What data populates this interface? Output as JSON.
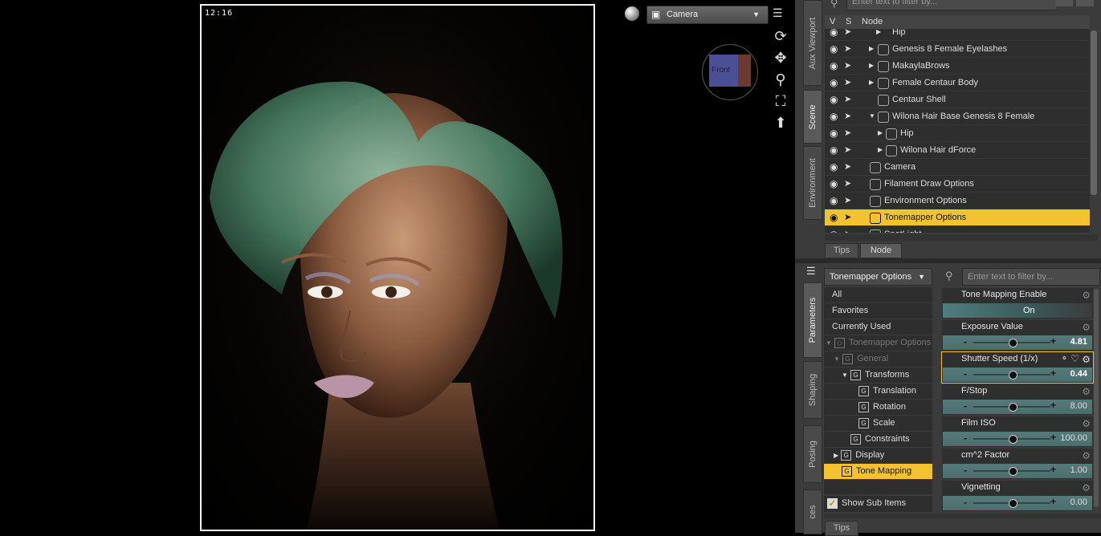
{
  "viewport": {
    "time": "12:16",
    "camera": "Camera",
    "gizmo_label": "Front"
  },
  "side_tabs_top": [
    "Aux Viewport",
    "Scene",
    "Environment"
  ],
  "side_tabs_bottom": [
    "Parameters",
    "Shaping",
    "Posing",
    "ces"
  ],
  "scene": {
    "filter_placeholder": "Enter text to filter by...",
    "col_v": "V",
    "col_s": "S",
    "col_node": "Node",
    "rows": [
      {
        "name": "Hip"
      },
      {
        "name": "Genesis 8 Female Eyelashes"
      },
      {
        "name": "MakaylaBrows"
      },
      {
        "name": "Female Centaur Body"
      },
      {
        "name": "Centaur Shell"
      },
      {
        "name": "Wilona Hair Base Genesis 8 Female"
      },
      {
        "name": "Hip"
      },
      {
        "name": "Wilona Hair dForce"
      },
      {
        "name": "Camera"
      },
      {
        "name": "Filament Draw Options"
      },
      {
        "name": "Environment Options"
      },
      {
        "name": "Tonemapper Options"
      },
      {
        "name": "SpotLight"
      }
    ],
    "bottom_tabs": [
      "Tips",
      "Node"
    ]
  },
  "params": {
    "node_select": "Tonemapper Options",
    "filter_placeholder": "Enter text to filter by...",
    "tree": [
      {
        "label": "All"
      },
      {
        "label": "Favorites"
      },
      {
        "label": "Currently Used"
      },
      {
        "label": "Tonemapper Options"
      },
      {
        "label": "General"
      },
      {
        "label": "Transforms"
      },
      {
        "label": "Translation"
      },
      {
        "label": "Rotation"
      },
      {
        "label": "Scale"
      },
      {
        "label": "Constraints"
      },
      {
        "label": "Display"
      },
      {
        "label": "Tone Mapping"
      }
    ],
    "show_sub_items": "Show Sub Items",
    "items": [
      {
        "label": "Tone Mapping Enable",
        "value": "On"
      },
      {
        "label": "Exposure Value",
        "value": "4.81"
      },
      {
        "label": "Shutter Speed (1/x)",
        "value": "0.44"
      },
      {
        "label": "F/Stop",
        "value": "8.00"
      },
      {
        "label": "Film ISO",
        "value": "100.00"
      },
      {
        "label": "cm^2 Factor",
        "value": "1.00"
      },
      {
        "label": "Vignetting",
        "value": "0.00"
      }
    ],
    "bottom_tab": "Tips"
  },
  "colors": {
    "accent": "#f2c230",
    "slider": "#537b7b",
    "panel": "#3b3b3b"
  }
}
